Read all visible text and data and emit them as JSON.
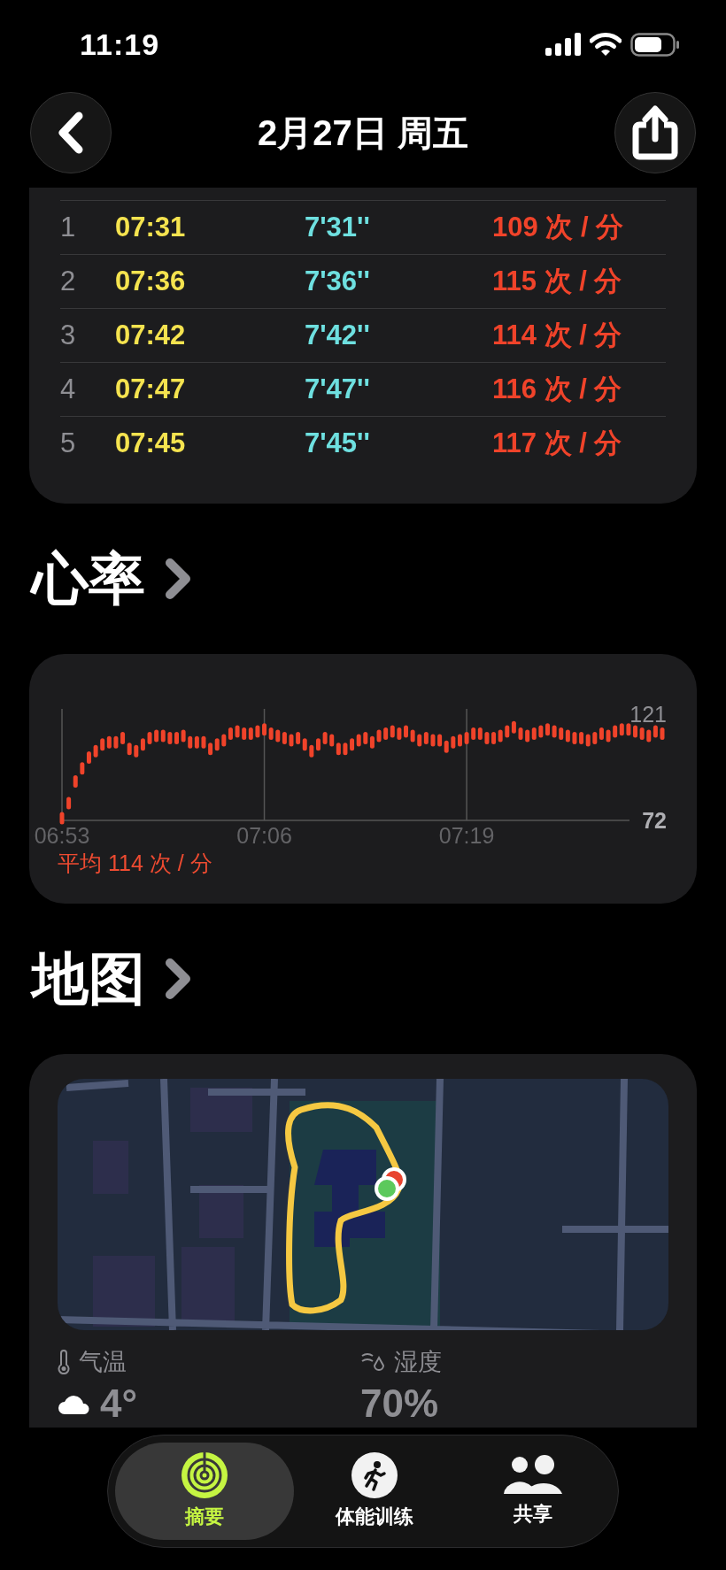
{
  "status_bar": {
    "time": "11:19"
  },
  "header": {
    "title": "2月27日 周五"
  },
  "splits": {
    "rows": [
      {
        "index": "1",
        "time": "07:31",
        "pace": "7'31''",
        "heart_rate": "109 次 / 分"
      },
      {
        "index": "2",
        "time": "07:36",
        "pace": "7'36''",
        "heart_rate": "115 次 / 分"
      },
      {
        "index": "3",
        "time": "07:42",
        "pace": "7'42''",
        "heart_rate": "114 次 / 分"
      },
      {
        "index": "4",
        "time": "07:47",
        "pace": "7'47''",
        "heart_rate": "116 次 / 分"
      },
      {
        "index": "5",
        "time": "07:45",
        "pace": "7'45''",
        "heart_rate": "117 次 / 分"
      }
    ]
  },
  "heart_rate": {
    "title": "心率",
    "chart_data": {
      "type": "scatter",
      "categories": [
        "06:53",
        null,
        null,
        null,
        null,
        null,
        null,
        null,
        null,
        null,
        null,
        null,
        null,
        null,
        null,
        null,
        null,
        null,
        null,
        null,
        null,
        null,
        null,
        null,
        null,
        null,
        null,
        null,
        null,
        null,
        "07:06",
        null,
        null,
        null,
        null,
        null,
        null,
        null,
        null,
        null,
        null,
        null,
        null,
        null,
        null,
        null,
        null,
        null,
        null,
        null,
        null,
        null,
        null,
        null,
        null,
        null,
        null,
        null,
        null,
        null,
        "07:19",
        null,
        null,
        null,
        null,
        null,
        null,
        null,
        null,
        null,
        null,
        null,
        null,
        null,
        null,
        null,
        null,
        null,
        null,
        null,
        null,
        null,
        null,
        null,
        null,
        null,
        null,
        null,
        null,
        null
      ],
      "series": [
        {
          "color": "#f0432a",
          "values": [
            73,
            80,
            90,
            96,
            101,
            104,
            107,
            108,
            108,
            110,
            105,
            104,
            107,
            110,
            111,
            111,
            110,
            110,
            111,
            108,
            108,
            108,
            105,
            107,
            109,
            112,
            113,
            112,
            112,
            113,
            114,
            112,
            111,
            110,
            109,
            110,
            107,
            104,
            107,
            110,
            109,
            105,
            105,
            107,
            109,
            110,
            108,
            111,
            112,
            113,
            112,
            113,
            111,
            109,
            110,
            109,
            109,
            106,
            108,
            109,
            110,
            112,
            112,
            110,
            110,
            111,
            113,
            115,
            112,
            111,
            112,
            113,
            114,
            113,
            112,
            111,
            110,
            110,
            109,
            110,
            112,
            111,
            113,
            114,
            114,
            113,
            112,
            111,
            113,
            112
          ]
        }
      ],
      "ylim": [
        72,
        121
      ],
      "grid": true,
      "yticks": [
        {
          "value": 72,
          "label": "72"
        },
        {
          "value": 121,
          "label": "121"
        }
      ]
    },
    "average": "平均 114 次 / 分"
  },
  "map": {
    "title": "地图",
    "weather": [
      {
        "kind": "temperature",
        "label": "气温",
        "value": "4°"
      },
      {
        "kind": "humidity",
        "label": "湿度",
        "value": "70%"
      }
    ]
  },
  "tab_bar": [
    {
      "kind": "summary",
      "label": "摘要",
      "selected": true
    },
    {
      "kind": "workout",
      "label": "体能训练",
      "selected": false
    },
    {
      "kind": "sharing",
      "label": "共享",
      "selected": false
    }
  ]
}
